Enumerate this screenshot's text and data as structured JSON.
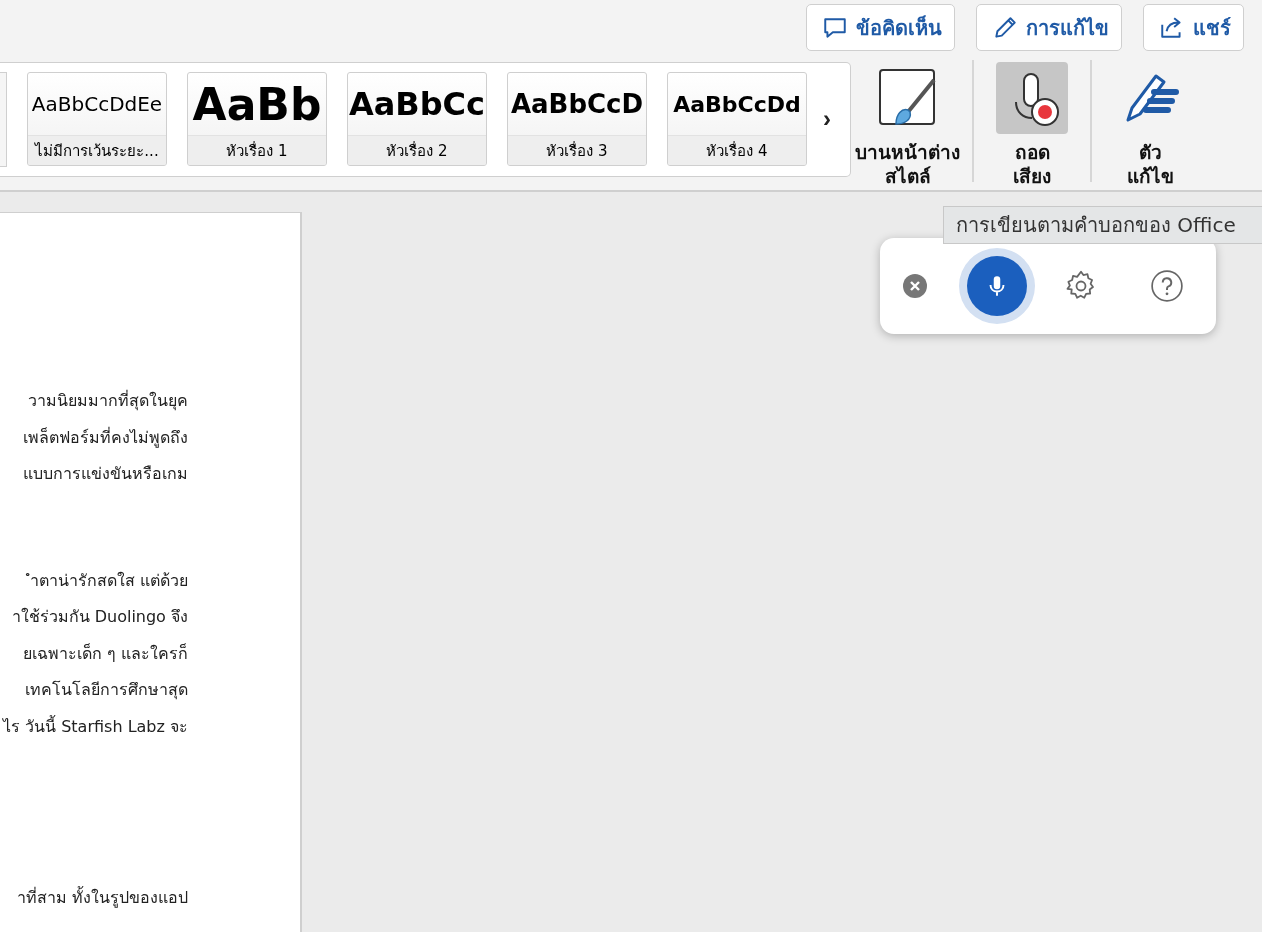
{
  "toolbar_buttons": [
    {
      "kind": "comment",
      "label": "ข้อคิดเห็น"
    },
    {
      "kind": "edit",
      "label": "การแก้ไข"
    },
    {
      "kind": "share",
      "label": "แชร์"
    }
  ],
  "styles": [
    {
      "kind": "normal",
      "preview": "AaBbCcDdEe",
      "label": "ไม่มีการเว้นระยะ..."
    },
    {
      "kind": "heading1",
      "preview": "AaBb",
      "label": "หัวเรื่อง 1"
    },
    {
      "kind": "heading2",
      "preview": "AaBbCc",
      "label": "หัวเรื่อง 2"
    },
    {
      "kind": "heading3",
      "preview": "AaBbCcD",
      "label": "หัวเรื่อง 3"
    },
    {
      "kind": "heading4",
      "preview": "AaBbCcDd",
      "label": "หัวเรื่อง 4"
    }
  ],
  "gallery_more": "›",
  "ribbon_buttons": [
    {
      "kind": "styles_pane",
      "lines": [
        "บานหน้าต่าง",
        "สไตล์"
      ],
      "selected": false
    },
    {
      "kind": "dictate",
      "lines": [
        "ถอด",
        "เสียง"
      ],
      "selected": true
    },
    {
      "kind": "editor",
      "lines": [
        "ตัว",
        "แก้ไข"
      ],
      "selected": false
    }
  ],
  "tooltip": "การเขียนตามคำบอกของ Office",
  "dictation": {
    "listening": true
  },
  "document": {
    "paragraphs": [
      [
        "วามนิยมมากที่สุดในยุค",
        "เพล็ตฟอร์มที่คงไม่พูดถึง",
        "แบบการแข่งขันหรือเกม"
      ],
      [
        "ำตาน่ารักสดใส แต่ด้วย",
        "าใช้ร่วมกัน Duolingo จึง",
        "ยเฉพาะเด็ก ๆ และใครก็",
        "เทคโนโลยีการศึกษาสุด",
        "ไร วันนี้ Starfish Labz จะ"
      ],
      [
        "าที่สาม ทั้งในรูปของแอป"
      ]
    ]
  }
}
